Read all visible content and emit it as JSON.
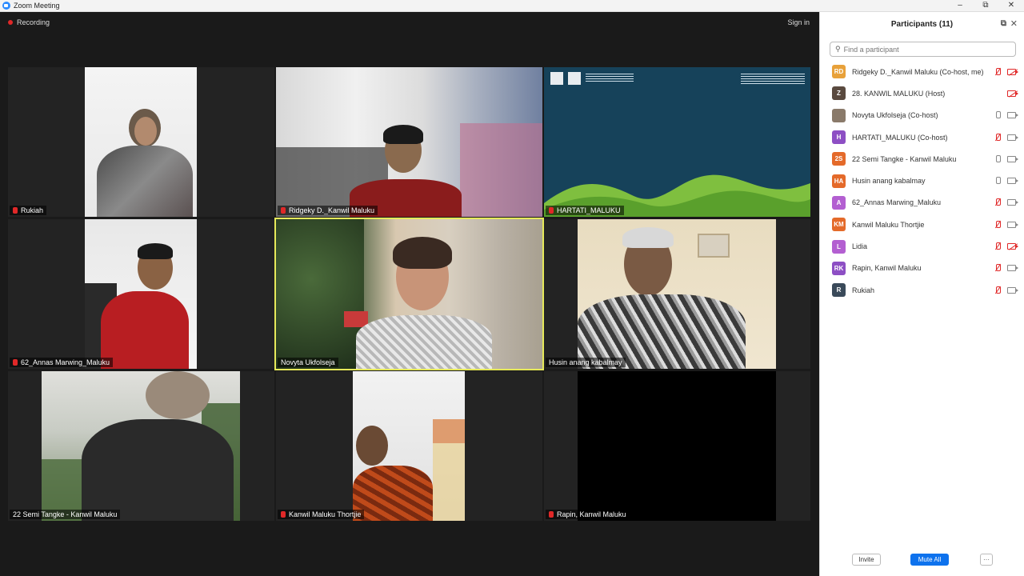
{
  "window": {
    "title": "Zoom Meeting",
    "minimize": "–",
    "maximize": "⧉",
    "close": "✕"
  },
  "meeting": {
    "recording_label": "Recording",
    "sign_in": "Sign in"
  },
  "tiles": [
    {
      "name": "Rukiah",
      "muted": true
    },
    {
      "name": "Ridgeky D._Kanwil Maluku",
      "muted": true
    },
    {
      "name": "HARTATI_MALUKU",
      "muted": true,
      "share_title": "PENDIDIKAN SOSIAL INTERIOR INKLUSIF KEMENTERIAN"
    },
    {
      "name": "62_Annas Marwing_Maluku",
      "muted": true
    },
    {
      "name": "Novyta Ukfolseja",
      "muted": false
    },
    {
      "name": "Husin anang kabalmay",
      "muted": false
    },
    {
      "name": "22 Semi Tangke - Kanwil Maluku",
      "muted": false
    },
    {
      "name": "Kanwil Maluku Thortjie",
      "muted": true
    },
    {
      "name": "Rapin, Kanwil Maluku",
      "muted": true
    }
  ],
  "panel": {
    "title": "Participants (11)",
    "search_placeholder": "Find a participant",
    "participants": [
      {
        "initials": "RD",
        "color": "#e8a13a",
        "name": "Ridgeky D._Kanwil Maluku (Co-host, me)",
        "mic": "off",
        "cam": "off"
      },
      {
        "initials": "Z",
        "color": "#5a4a3f",
        "name": "28. KANWIL MALUKU (Host)",
        "mic": "none",
        "cam": "off"
      },
      {
        "initials": "",
        "color": "#8a7a6a",
        "name": "Novyta Ukfolseja (Co-host)",
        "mic": "on",
        "cam": "on"
      },
      {
        "initials": "H",
        "color": "#8d4fc4",
        "name": "HARTATI_MALUKU (Co-host)",
        "mic": "off",
        "cam": "on"
      },
      {
        "initials": "2S",
        "color": "#e46a2a",
        "name": "22 Semi Tangke - Kanwil Maluku",
        "mic": "on",
        "cam": "on"
      },
      {
        "initials": "HA",
        "color": "#e46a2a",
        "name": "Husin anang kabalmay",
        "mic": "on",
        "cam": "on"
      },
      {
        "initials": "A",
        "color": "#b35fd1",
        "name": "62_Annas Marwing_Maluku",
        "mic": "off",
        "cam": "on"
      },
      {
        "initials": "KM",
        "color": "#e46a2a",
        "name": "Kanwil Maluku Thortjie",
        "mic": "off",
        "cam": "on"
      },
      {
        "initials": "L",
        "color": "#b35fd1",
        "name": "Lidia",
        "mic": "off",
        "cam": "off"
      },
      {
        "initials": "RK",
        "color": "#8d4fc4",
        "name": "Rapin, Kanwil Maluku",
        "mic": "off",
        "cam": "on"
      },
      {
        "initials": "R",
        "color": "#3a4a5a",
        "name": "Rukiah",
        "mic": "off",
        "cam": "on"
      }
    ],
    "invite_label": "Invite",
    "mute_all_label": "Mute All",
    "more_label": "···"
  }
}
